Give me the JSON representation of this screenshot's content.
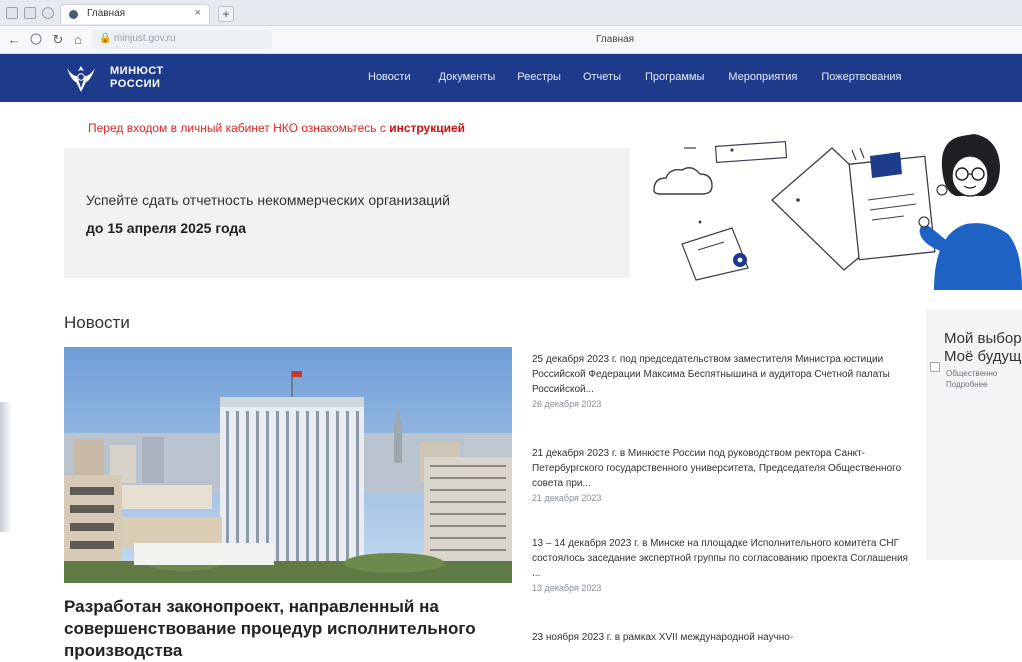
{
  "browser": {
    "tab_title": "Главная",
    "tab_close": "×",
    "new_tab": "+",
    "page_title": "Главная",
    "url": "minjust.gov.ru"
  },
  "header": {
    "logo_line1": "МИНЮСТ",
    "logo_line2": "РОССИИ",
    "nav": [
      "Новости",
      "Документы",
      "Реестры",
      "Отчеты",
      "Программы",
      "Мероприятия",
      "Пожертвования"
    ],
    "brand_color": "#1e3a8a"
  },
  "alert": {
    "text": "Перед входом в личный кабинет НКО ознакомьтесь с ",
    "link": "инструкцией",
    "color": "#e02424"
  },
  "banner": {
    "line1": "Успейте сдать отчетность некоммерческих организаций",
    "line2": "до 15 апреля 2025 года"
  },
  "news": {
    "heading": "Новости",
    "headline": "Разработан законопроект, направленный на совершенствование процедур исполнительного производства",
    "items": [
      {
        "text": "25 декабря 2023 г. под председательством заместителя Министра юстиции Российской Федерации Максима Беспятнышина и аудитора Счетной палаты Российской...",
        "date": "26 декабря 2023"
      },
      {
        "text": "21 декабря 2023 г. в Минюсте России под руководством ректора Санкт-Петербургского государственного университета, Председателя Общественного совета при...",
        "date": "21 декабря 2023"
      },
      {
        "text": "13 – 14 декабря 2023 г. в Минске на площадке Исполнительного комитета СНГ состоялось заседание экспертной группы по согласованию проекта Соглашения ...",
        "date": "13 декабря 2023"
      },
      {
        "text": "23 ноября 2023 г. в рамках XVII международной научно-",
        "date": ""
      }
    ]
  },
  "promo": {
    "title_line1": "Мой выбор",
    "title_line2": "Моё будущее",
    "small_line1": "Общественно",
    "small_line2": "Подробнее"
  }
}
